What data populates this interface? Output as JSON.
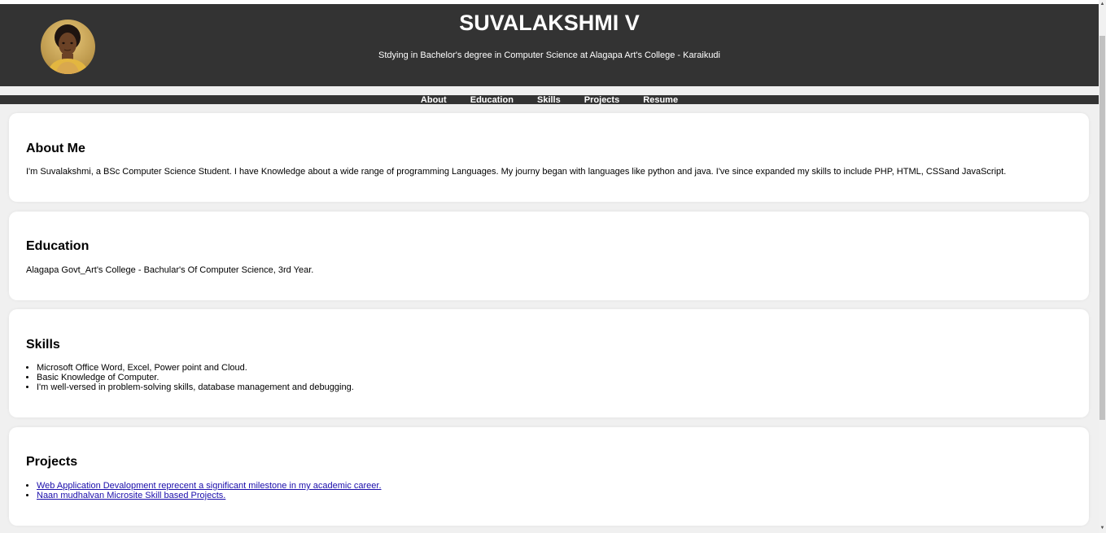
{
  "header": {
    "name": "SUVALAKSHMI V",
    "subtitle": "Stdying in Bachelor's degree in Computer Science at Alagapa Art's College - Karaikudi",
    "avatar_icon": "profile-photo"
  },
  "nav": {
    "items": [
      {
        "label": "About"
      },
      {
        "label": "Education"
      },
      {
        "label": "Skills"
      },
      {
        "label": "Projects"
      },
      {
        "label": "Resume"
      }
    ]
  },
  "about": {
    "heading": "About Me",
    "text": "I'm Suvalakshmi, a BSc Computer Science Student. I have Knowledge about a wide range of programming Languages. My journy began with languages like python and java. I've since expanded my skills to include PHP, HTML, CSSand JavaScript."
  },
  "education": {
    "heading": "Education",
    "text": "Alagapa Govt_Art's College - Bachular's Of Computer Science, 3rd Year."
  },
  "skills": {
    "heading": "Skills",
    "items": [
      "Microsoft Office Word, Excel, Power point and Cloud.",
      "Basic Knowledge of Computer.",
      "I'm well-versed in problem-solving skills, database management and debugging."
    ]
  },
  "projects": {
    "heading": "Projects",
    "items": [
      "Web Application Devalopment reprecent a significant milestone in my academic career.",
      "Naan mudhalvan Microsite Skill based Projects."
    ]
  },
  "colors": {
    "header_bg": "#333333",
    "page_bg": "#f0f0f0",
    "card_bg": "#ffffff",
    "link": "#1a0dab"
  }
}
